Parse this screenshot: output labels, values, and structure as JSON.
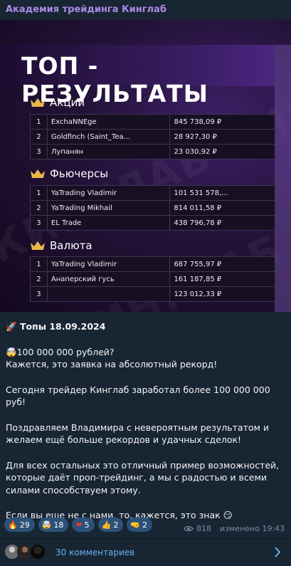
{
  "channel": {
    "name": "Академия трейдинга Кинглаб"
  },
  "banner": {
    "headline": "ТОП - РЕЗУЛЬТАТЫ",
    "watermark": "КИНГЛАБ КИНГЛАБ",
    "sections": [
      {
        "title": "Акции",
        "rows": [
          {
            "rank": "1",
            "name": "ExchaNNEge",
            "value": "845 738,09 ₽"
          },
          {
            "rank": "2",
            "name": "Goldfinch (Saint_Tea...",
            "value": "28 927,30 ₽"
          },
          {
            "rank": "3",
            "name": "Лупанян",
            "value": "23 030,92 ₽"
          }
        ]
      },
      {
        "title": "Фьючерсы",
        "rows": [
          {
            "rank": "1",
            "name": "YaTrading Vladimir",
            "value": "101 531 578,..."
          },
          {
            "rank": "2",
            "name": "YaTrading Mikhail",
            "value": "814 011,58 ₽"
          },
          {
            "rank": "3",
            "name": "EL Trade",
            "value": "438 796,78 ₽"
          }
        ]
      },
      {
        "title": "Валюта",
        "rows": [
          {
            "rank": "1",
            "name": "YaTrading Vladimir",
            "value": "687 755,97 ₽"
          },
          {
            "rank": "2",
            "name": "Анаперский гусь",
            "value": "161 187,85 ₽"
          },
          {
            "rank": "3",
            "name": "",
            "value": "123 012,33 ₽"
          }
        ]
      }
    ]
  },
  "message": {
    "title": "Топы 18.09.2024",
    "line1": "100 000 000 рублей?",
    "line2": "Кажется, это заявка на абсолютный рекорд!",
    "para2": "Сегодня трейдер Кинглаб заработал более 100 000 000 руб!",
    "para3": "Поздравляем Владимира с невероятным результатом и желаем ещё больше рекордов и удачных сделок!",
    "para4": "Для всех остальных это отличный пример возможностей, которые даёт проп-трейдинг, а мы с радостью и всеми силами способствуем этому.",
    "para5": "Если вы еще не с нами, то, кажется, это знак"
  },
  "reactions": [
    {
      "emoji": "🔥",
      "count": "29"
    },
    {
      "emoji": "🤯",
      "count": "18"
    },
    {
      "emoji": "❤",
      "count": "5"
    },
    {
      "emoji": "👍",
      "count": "2"
    },
    {
      "emoji": "🤜",
      "count": "2"
    }
  ],
  "meta": {
    "views": "818",
    "edited": "изменено 19:43"
  },
  "comments": {
    "label": "30 комментариев"
  },
  "colors": {
    "accent": "#6ab3f3",
    "channel": "#a98ae6",
    "reaction_bg": "#2b5278"
  },
  "icons": {
    "rocket": "rocket-icon",
    "exploding_head": "exploding-head-icon",
    "smirk": "smirk-icon",
    "eye": "eye-icon",
    "crown": "crown-icon",
    "chevron": "chevron-right-icon"
  }
}
